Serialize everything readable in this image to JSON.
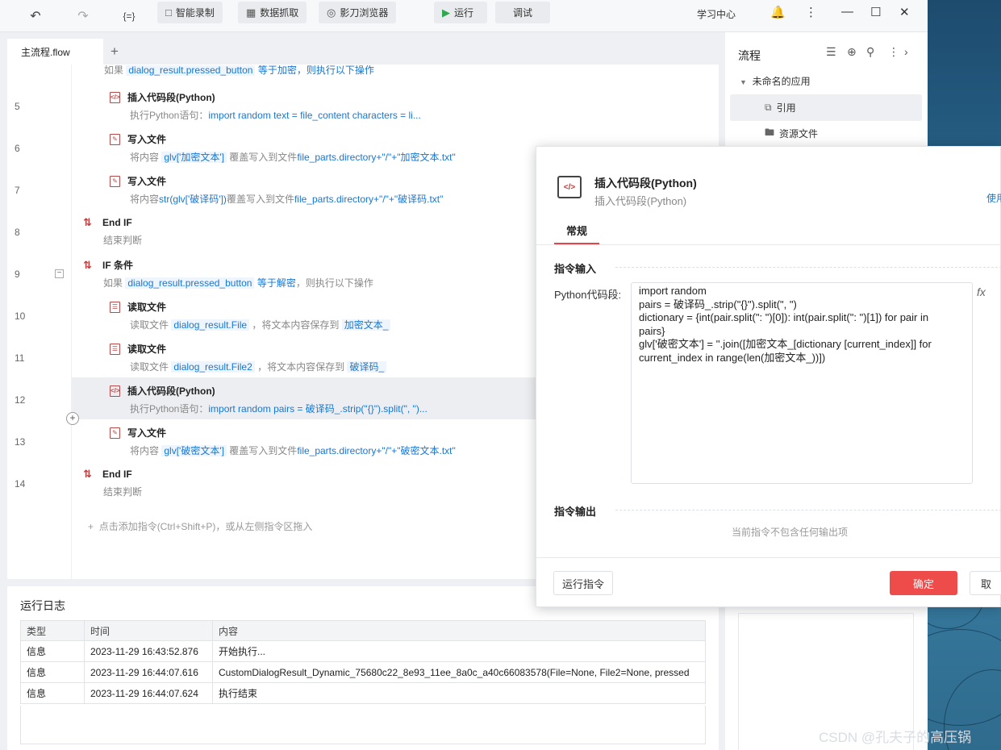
{
  "toolbar": {
    "undo_icon": "undo-icon",
    "redo_icon": "redo-icon",
    "variables_label": "{=}",
    "smart_record": "智能录制",
    "data_capture": "数据抓取",
    "browser": "影刀浏览器",
    "run": "运行",
    "debug": "调试",
    "learning_center": "学习中心"
  },
  "tabs": [
    {
      "label": "主流程.flow"
    }
  ],
  "lines": [
    "5",
    "6",
    "7",
    "8",
    "9",
    "10",
    "11",
    "12",
    "13",
    "14"
  ],
  "steps": {
    "top_cut": {
      "prefix": "如果",
      "var": "dialog_result.pressed_button",
      "rest": "等于加密，则执行以下操作"
    },
    "s5": {
      "title": "插入代码段(Python)",
      "prefix": "执行Python语句：",
      "code": "import random  text = file_content characters = li..."
    },
    "s6": {
      "title": "写入文件",
      "prefix": "将内容",
      "var": "glv['加密文本']",
      "mid": "覆盖写入到文件",
      "path": "file_parts.directory+\"/\"+\"加密文本.txt\""
    },
    "s7": {
      "title": "写入文件",
      "prefix": "将内容",
      "var": "str(glv['破译码'])",
      "mid": "覆盖写入到文件",
      "path": "file_parts.directory+\"/\"+\"破译码.txt\""
    },
    "s8": {
      "title": "End IF",
      "desc": "结束判断"
    },
    "s9": {
      "title": "IF 条件",
      "prefix": "如果",
      "var": "dialog_result.pressed_button",
      "rest": "等于解密",
      "tail": "，则执行以下操作"
    },
    "s10": {
      "title": "读取文件",
      "prefix": "读取文件",
      "var": "dialog_result.File",
      "mid": "，将文本内容保存到",
      "target": "加密文本_"
    },
    "s11": {
      "title": "读取文件",
      "prefix": "读取文件",
      "var": "dialog_result.File2",
      "mid": "，将文本内容保存到",
      "target": "破译码_"
    },
    "s12": {
      "title": "插入代码段(Python)",
      "prefix": "执行Python语句：",
      "code": "import random pairs = 破译码_.strip(\"{}\").split(\", \")..."
    },
    "s13": {
      "title": "写入文件",
      "prefix": "将内容",
      "var": "glv['破密文本']",
      "mid": "覆盖写入到文件",
      "path": "file_parts.directory+\"/\"+\"破密文本.txt\""
    },
    "s14": {
      "title": "End IF",
      "desc": "结束判断"
    }
  },
  "add_hint": "点击添加指令(Ctrl+Shift+P)，或从左侧指令区拖入",
  "log": {
    "title": "运行日志",
    "columns": [
      "类型",
      "时间",
      "内容"
    ],
    "rows": [
      [
        "信息",
        "2023-11-29 16:43:52.876",
        "开始执行..."
      ],
      [
        "信息",
        "2023-11-29 16:44:07.616",
        "CustomDialogResult_Dynamic_75680c22_8e93_11ee_8a0c_a40c66083578(File=None, File2=None, pressed"
      ],
      [
        "信息",
        "2023-11-29 16:44:07.624",
        "执行结束"
      ]
    ]
  },
  "sidebar": {
    "title": "流程",
    "root": "未命名的应用",
    "items": [
      {
        "label": "引用"
      },
      {
        "label": "资源文件"
      }
    ]
  },
  "dialog": {
    "title": "插入代码段(Python)",
    "subtitle": "插入代码段(Python)",
    "help_link": "使用",
    "tab": "常规",
    "section_input": "指令输入",
    "field_label": "Python代码段:",
    "code_lines": [
      "import random",
      "pairs = 破译码_.strip(\"{}\").split(\", \")",
      "dictionary = {int(pair.split(\": \")[0]): int(pair.split(\": \")[1]) for pair in",
      "pairs}",
      "glv['破密文本'] = ''.join([加密文本_[dictionary [current_index]] for",
      "current_index in range(len(加密文本_))])"
    ],
    "fx_label": "fx",
    "section_output": "指令输出",
    "no_output": "当前指令不包含任何输出项",
    "run_button": "运行指令",
    "ok_button": "确定",
    "cancel_button": "取"
  },
  "watermark": "CSDN @孔夫子的高压锅",
  "colors": {
    "accent": "#ee4b4b",
    "link": "#1677d2"
  }
}
